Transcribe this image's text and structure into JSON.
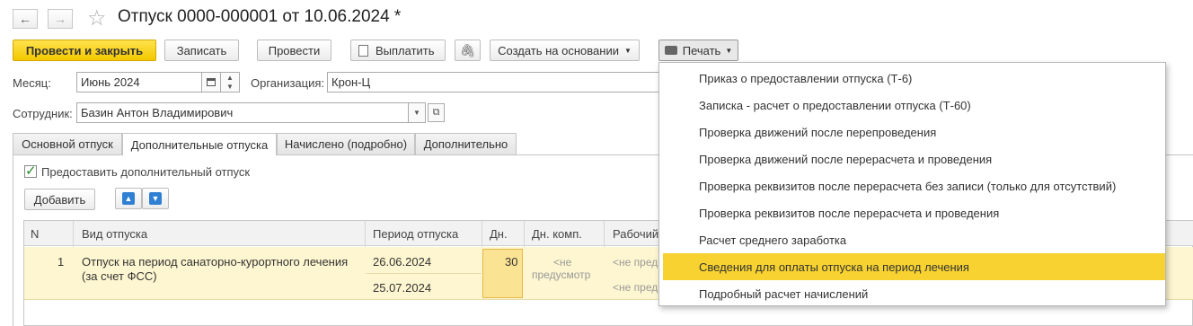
{
  "window": {
    "title": "Отпуск 0000-000001 от 10.06.2024 *"
  },
  "nav": {
    "back": "←",
    "forward": "→",
    "star": "☆"
  },
  "toolbar": {
    "post_close": "Провести и закрыть",
    "save": "Записать",
    "post": "Провести",
    "pay": "Выплатить",
    "create_based": "Создать на основании",
    "print": "Печать"
  },
  "form": {
    "month_label": "Месяц:",
    "month_value": "Июнь 2024",
    "org_label": "Организация:",
    "org_value": "Крон-Ц",
    "employee_label": "Сотрудник:",
    "employee_value": "Базин Антон Владимирович"
  },
  "tabs": [
    "Основной отпуск",
    "Дополнительные отпуска",
    "Начислено (подробно)",
    "Дополнительно"
  ],
  "extra_leave": {
    "checkbox_label": "Предоставить дополнительный отпуск",
    "checked": true,
    "add_button": "Добавить"
  },
  "table": {
    "headers": {
      "n": "N",
      "type": "Вид отпуска",
      "period": "Период отпуска",
      "days": "Дн.",
      "comp": "Дн. комп.",
      "work": "Рабочий"
    },
    "rows": [
      {
        "n": "1",
        "type": "Отпуск на период санаторно-курортного лечения (за счет ФСС)",
        "start": "26.06.2024",
        "end": "25.07.2024",
        "days": "30",
        "comp_line1": "<не",
        "comp_line2": "предусмотр",
        "work1": "<не пред",
        "work2": "<не пред"
      }
    ]
  },
  "print_menu": {
    "items": [
      "Приказ о предоставлении отпуска (Т-6)",
      "Записка - расчет о предоставлении отпуска (Т-60)",
      "Проверка движений после перепроведения",
      "Проверка движений после перерасчета и проведения",
      "Проверка реквизитов после перерасчета без записи (только для отсутствий)",
      "Проверка реквизитов после перерасчета и проведения",
      "Расчет среднего заработка",
      "Сведения для оплаты отпуска на период лечения",
      "Подробный расчет начислений"
    ],
    "selected_index": 7
  },
  "colors": {
    "accent_yellow": "#f7d230",
    "row_highlight": "#fdf6d0",
    "cell_selected": "#fbe394"
  }
}
